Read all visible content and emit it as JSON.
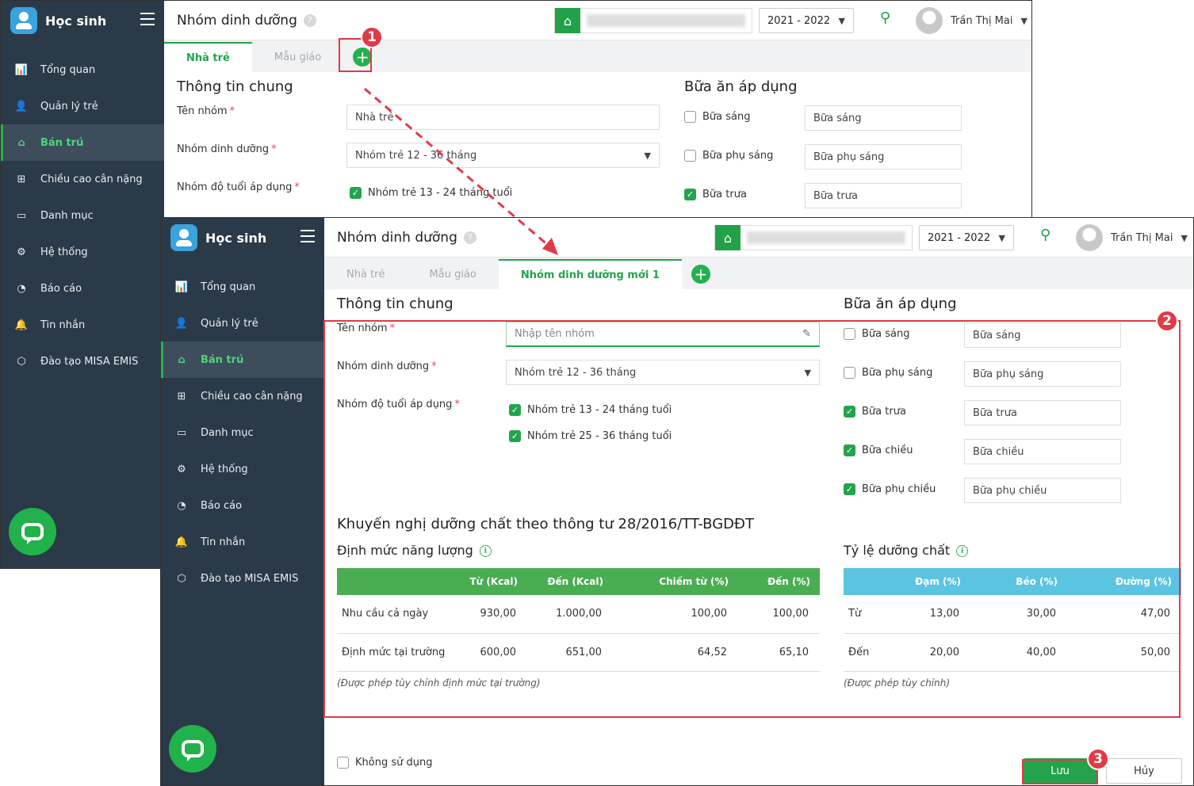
{
  "app": {
    "name": "Học sinh"
  },
  "sidebar": {
    "items": [
      {
        "label": "Tổng quan",
        "icon": "bar-chart-icon"
      },
      {
        "label": "Quản lý trẻ",
        "icon": "child-icon"
      },
      {
        "label": "Bán trú",
        "icon": "home-icon",
        "active": true
      },
      {
        "label": "Chiều cao cân nặng",
        "icon": "plus-square-icon"
      },
      {
        "label": "Danh mục",
        "icon": "folder-icon"
      },
      {
        "label": "Hệ thống",
        "icon": "gear-icon"
      },
      {
        "label": "Báo cáo",
        "icon": "pie-chart-icon"
      },
      {
        "label": "Tin nhắn",
        "icon": "bell-icon"
      },
      {
        "label": "Đào tạo MISA EMIS",
        "icon": "cube-icon"
      }
    ]
  },
  "header": {
    "title": "Nhóm dinh dưỡng",
    "help": "?",
    "year": "2021 - 2022",
    "user": "Trần Thị Mai"
  },
  "win1": {
    "tabs": [
      "Nhà trẻ",
      "Mẫu giáo"
    ],
    "general_title": "Thông tin chung",
    "meals_title": "Bữa ăn áp dụng",
    "group_name_label": "Tên nhóm",
    "group_name_value": "Nhà trẻ",
    "nutrition_label": "Nhóm dinh dưỡng",
    "nutrition_value": "Nhóm trẻ 12 - 36 tháng",
    "age_label": "Nhóm độ tuổi áp dụng",
    "age_options": [
      "Nhóm trẻ 13 - 24 tháng tuổi"
    ],
    "meals": [
      {
        "label": "Bữa sáng",
        "value": "Bữa sáng",
        "checked": false
      },
      {
        "label": "Bữa phụ sáng",
        "value": "Bữa phụ sáng",
        "checked": false
      },
      {
        "label": "Bữa trưa",
        "value": "Bữa trưa",
        "checked": true
      }
    ]
  },
  "win2": {
    "tabs": [
      "Nhà trẻ",
      "Mẫu giáo",
      "Nhóm dinh dưỡng mới 1"
    ],
    "general_title": "Thông tin chung",
    "meals_title": "Bữa ăn áp dụng",
    "group_name_label": "Tên nhóm",
    "group_name_placeholder": "Nhập tên nhóm",
    "nutrition_label": "Nhóm dinh dưỡng",
    "nutrition_value": "Nhóm trẻ 12 - 36 tháng",
    "age_label": "Nhóm độ tuổi áp dụng",
    "age_options": [
      "Nhóm trẻ 13 - 24 tháng tuổi",
      "Nhóm trẻ 25 - 36 tháng tuổi"
    ],
    "meals": [
      {
        "label": "Bữa sáng",
        "value": "Bữa sáng",
        "checked": false
      },
      {
        "label": "Bữa phụ sáng",
        "value": "Bữa phụ sáng",
        "checked": false
      },
      {
        "label": "Bữa trưa",
        "value": "Bữa trưa",
        "checked": true
      },
      {
        "label": "Bữa chiều",
        "value": "Bữa chiều",
        "checked": true
      },
      {
        "label": "Bữa phụ chiều",
        "value": "Bữa phụ chiều",
        "checked": true
      }
    ],
    "recommend_title": "Khuyến nghị dưỡng chất theo thông tư 28/2016/TT-BGDĐT",
    "energy_title": "Định mức năng lượng",
    "energy_headers": [
      "",
      "Từ (Kcal)",
      "Đến (Kcal)",
      "Chiếm từ (%)",
      "Đến (%)"
    ],
    "energy_rows": [
      [
        "Nhu cầu cả ngày",
        "930,00",
        "1.000,00",
        "100,00",
        "100,00"
      ],
      [
        "Định mức tại trường",
        "600,00",
        "651,00",
        "64,52",
        "65,10"
      ]
    ],
    "energy_note": "(Được phép tùy chỉnh định mức tại trường)",
    "ratio_title": "Tỷ lệ dưỡng chất",
    "ratio_headers": [
      "",
      "Đạm (%)",
      "Béo (%)",
      "Đường (%)"
    ],
    "ratio_rows": [
      [
        "Từ",
        "13,00",
        "30,00",
        "47,00"
      ],
      [
        "Đến",
        "20,00",
        "40,00",
        "50,00"
      ]
    ],
    "ratio_note": "(Được phép tùy chỉnh)",
    "unused_label": "Không sử dụng",
    "save_label": "Lưu",
    "cancel_label": "Hủy"
  },
  "badges": [
    "1",
    "2",
    "3"
  ],
  "colors": {
    "accent": "#23a34d",
    "sidebar": "#2b3a48",
    "highlight": "#e23a45",
    "ratio_header": "#5bc4e0"
  }
}
